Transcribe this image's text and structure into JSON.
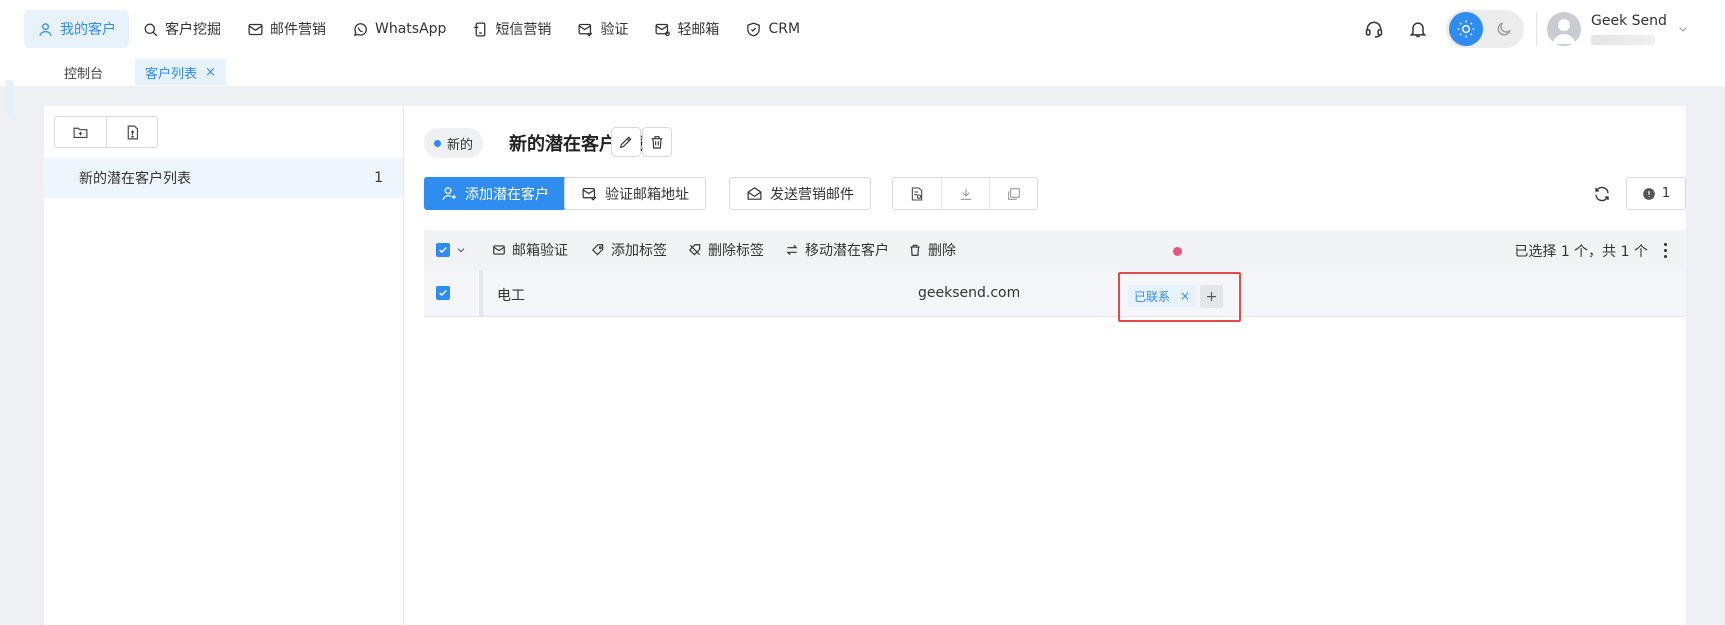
{
  "nav": {
    "items": [
      {
        "label": "我的客户",
        "icon": "user-icon",
        "active": true
      },
      {
        "label": "客户挖掘",
        "icon": "search-icon",
        "active": false
      },
      {
        "label": "邮件营销",
        "icon": "mail-icon",
        "active": false
      },
      {
        "label": "WhatsApp",
        "icon": "whatsapp-icon",
        "active": false
      },
      {
        "label": "短信营销",
        "icon": "sms-icon",
        "active": false
      },
      {
        "label": "验证",
        "icon": "mail-check-icon",
        "active": false
      },
      {
        "label": "轻邮箱",
        "icon": "mail-lite-icon",
        "active": false
      },
      {
        "label": "CRM",
        "icon": "crm-shield-icon",
        "active": false
      }
    ]
  },
  "user": {
    "name": "Geek Send"
  },
  "theme": {
    "active": "light",
    "accent": "#2f8cf0"
  },
  "tabs": {
    "home": "控制台",
    "active": "客户列表",
    "close": "×"
  },
  "sidebar": {
    "lists": [
      {
        "name": "新的潜在客户列表",
        "count": "1"
      }
    ]
  },
  "main": {
    "status": "新的",
    "title": "新的潜在客户列表",
    "buttons": {
      "add_lead": "添加潜在客户",
      "verify_email": "验证邮箱地址",
      "send_marketing": "发送营销邮件"
    },
    "issue_count": "1"
  },
  "table": {
    "bulk_actions": {
      "email_verify": "邮箱验证",
      "add_tag": "添加标签",
      "remove_tag": "删除标签",
      "move_lead": "移动潜在客户",
      "delete": "删除"
    },
    "selected_info": "已选择 1 个，共 1 个",
    "rows": [
      {
        "name": "电工",
        "email": "geeksend.com",
        "tag": "已联系",
        "tag_close": "×",
        "tag_add": "+"
      }
    ]
  },
  "colors": {
    "primary": "#2f8cf0",
    "highlight_border": "#e34b4b",
    "dot": "#f0507e"
  }
}
